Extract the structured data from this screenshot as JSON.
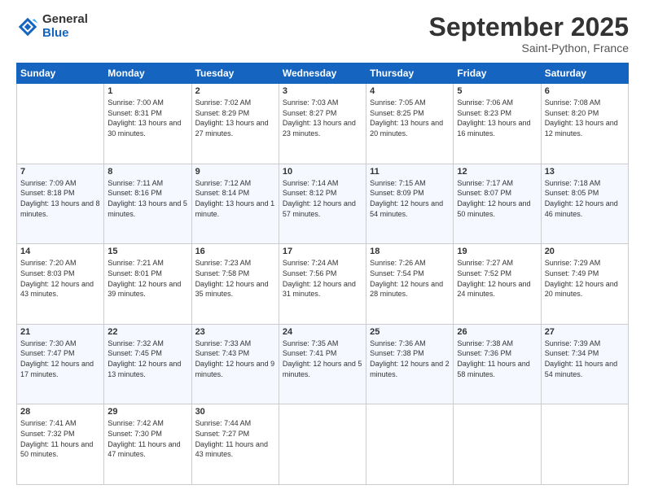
{
  "logo": {
    "general": "General",
    "blue": "Blue"
  },
  "header": {
    "month": "September 2025",
    "location": "Saint-Python, France"
  },
  "weekdays": [
    "Sunday",
    "Monday",
    "Tuesday",
    "Wednesday",
    "Thursday",
    "Friday",
    "Saturday"
  ],
  "weeks": [
    [
      {
        "day": "",
        "sunrise": "",
        "sunset": "",
        "daylight": ""
      },
      {
        "day": "1",
        "sunrise": "Sunrise: 7:00 AM",
        "sunset": "Sunset: 8:31 PM",
        "daylight": "Daylight: 13 hours and 30 minutes."
      },
      {
        "day": "2",
        "sunrise": "Sunrise: 7:02 AM",
        "sunset": "Sunset: 8:29 PM",
        "daylight": "Daylight: 13 hours and 27 minutes."
      },
      {
        "day": "3",
        "sunrise": "Sunrise: 7:03 AM",
        "sunset": "Sunset: 8:27 PM",
        "daylight": "Daylight: 13 hours and 23 minutes."
      },
      {
        "day": "4",
        "sunrise": "Sunrise: 7:05 AM",
        "sunset": "Sunset: 8:25 PM",
        "daylight": "Daylight: 13 hours and 20 minutes."
      },
      {
        "day": "5",
        "sunrise": "Sunrise: 7:06 AM",
        "sunset": "Sunset: 8:23 PM",
        "daylight": "Daylight: 13 hours and 16 minutes."
      },
      {
        "day": "6",
        "sunrise": "Sunrise: 7:08 AM",
        "sunset": "Sunset: 8:20 PM",
        "daylight": "Daylight: 13 hours and 12 minutes."
      }
    ],
    [
      {
        "day": "7",
        "sunrise": "Sunrise: 7:09 AM",
        "sunset": "Sunset: 8:18 PM",
        "daylight": "Daylight: 13 hours and 8 minutes."
      },
      {
        "day": "8",
        "sunrise": "Sunrise: 7:11 AM",
        "sunset": "Sunset: 8:16 PM",
        "daylight": "Daylight: 13 hours and 5 minutes."
      },
      {
        "day": "9",
        "sunrise": "Sunrise: 7:12 AM",
        "sunset": "Sunset: 8:14 PM",
        "daylight": "Daylight: 13 hours and 1 minute."
      },
      {
        "day": "10",
        "sunrise": "Sunrise: 7:14 AM",
        "sunset": "Sunset: 8:12 PM",
        "daylight": "Daylight: 12 hours and 57 minutes."
      },
      {
        "day": "11",
        "sunrise": "Sunrise: 7:15 AM",
        "sunset": "Sunset: 8:09 PM",
        "daylight": "Daylight: 12 hours and 54 minutes."
      },
      {
        "day": "12",
        "sunrise": "Sunrise: 7:17 AM",
        "sunset": "Sunset: 8:07 PM",
        "daylight": "Daylight: 12 hours and 50 minutes."
      },
      {
        "day": "13",
        "sunrise": "Sunrise: 7:18 AM",
        "sunset": "Sunset: 8:05 PM",
        "daylight": "Daylight: 12 hours and 46 minutes."
      }
    ],
    [
      {
        "day": "14",
        "sunrise": "Sunrise: 7:20 AM",
        "sunset": "Sunset: 8:03 PM",
        "daylight": "Daylight: 12 hours and 43 minutes."
      },
      {
        "day": "15",
        "sunrise": "Sunrise: 7:21 AM",
        "sunset": "Sunset: 8:01 PM",
        "daylight": "Daylight: 12 hours and 39 minutes."
      },
      {
        "day": "16",
        "sunrise": "Sunrise: 7:23 AM",
        "sunset": "Sunset: 7:58 PM",
        "daylight": "Daylight: 12 hours and 35 minutes."
      },
      {
        "day": "17",
        "sunrise": "Sunrise: 7:24 AM",
        "sunset": "Sunset: 7:56 PM",
        "daylight": "Daylight: 12 hours and 31 minutes."
      },
      {
        "day": "18",
        "sunrise": "Sunrise: 7:26 AM",
        "sunset": "Sunset: 7:54 PM",
        "daylight": "Daylight: 12 hours and 28 minutes."
      },
      {
        "day": "19",
        "sunrise": "Sunrise: 7:27 AM",
        "sunset": "Sunset: 7:52 PM",
        "daylight": "Daylight: 12 hours and 24 minutes."
      },
      {
        "day": "20",
        "sunrise": "Sunrise: 7:29 AM",
        "sunset": "Sunset: 7:49 PM",
        "daylight": "Daylight: 12 hours and 20 minutes."
      }
    ],
    [
      {
        "day": "21",
        "sunrise": "Sunrise: 7:30 AM",
        "sunset": "Sunset: 7:47 PM",
        "daylight": "Daylight: 12 hours and 17 minutes."
      },
      {
        "day": "22",
        "sunrise": "Sunrise: 7:32 AM",
        "sunset": "Sunset: 7:45 PM",
        "daylight": "Daylight: 12 hours and 13 minutes."
      },
      {
        "day": "23",
        "sunrise": "Sunrise: 7:33 AM",
        "sunset": "Sunset: 7:43 PM",
        "daylight": "Daylight: 12 hours and 9 minutes."
      },
      {
        "day": "24",
        "sunrise": "Sunrise: 7:35 AM",
        "sunset": "Sunset: 7:41 PM",
        "daylight": "Daylight: 12 hours and 5 minutes."
      },
      {
        "day": "25",
        "sunrise": "Sunrise: 7:36 AM",
        "sunset": "Sunset: 7:38 PM",
        "daylight": "Daylight: 12 hours and 2 minutes."
      },
      {
        "day": "26",
        "sunrise": "Sunrise: 7:38 AM",
        "sunset": "Sunset: 7:36 PM",
        "daylight": "Daylight: 11 hours and 58 minutes."
      },
      {
        "day": "27",
        "sunrise": "Sunrise: 7:39 AM",
        "sunset": "Sunset: 7:34 PM",
        "daylight": "Daylight: 11 hours and 54 minutes."
      }
    ],
    [
      {
        "day": "28",
        "sunrise": "Sunrise: 7:41 AM",
        "sunset": "Sunset: 7:32 PM",
        "daylight": "Daylight: 11 hours and 50 minutes."
      },
      {
        "day": "29",
        "sunrise": "Sunrise: 7:42 AM",
        "sunset": "Sunset: 7:30 PM",
        "daylight": "Daylight: 11 hours and 47 minutes."
      },
      {
        "day": "30",
        "sunrise": "Sunrise: 7:44 AM",
        "sunset": "Sunset: 7:27 PM",
        "daylight": "Daylight: 11 hours and 43 minutes."
      },
      {
        "day": "",
        "sunrise": "",
        "sunset": "",
        "daylight": ""
      },
      {
        "day": "",
        "sunrise": "",
        "sunset": "",
        "daylight": ""
      },
      {
        "day": "",
        "sunrise": "",
        "sunset": "",
        "daylight": ""
      },
      {
        "day": "",
        "sunrise": "",
        "sunset": "",
        "daylight": ""
      }
    ]
  ]
}
